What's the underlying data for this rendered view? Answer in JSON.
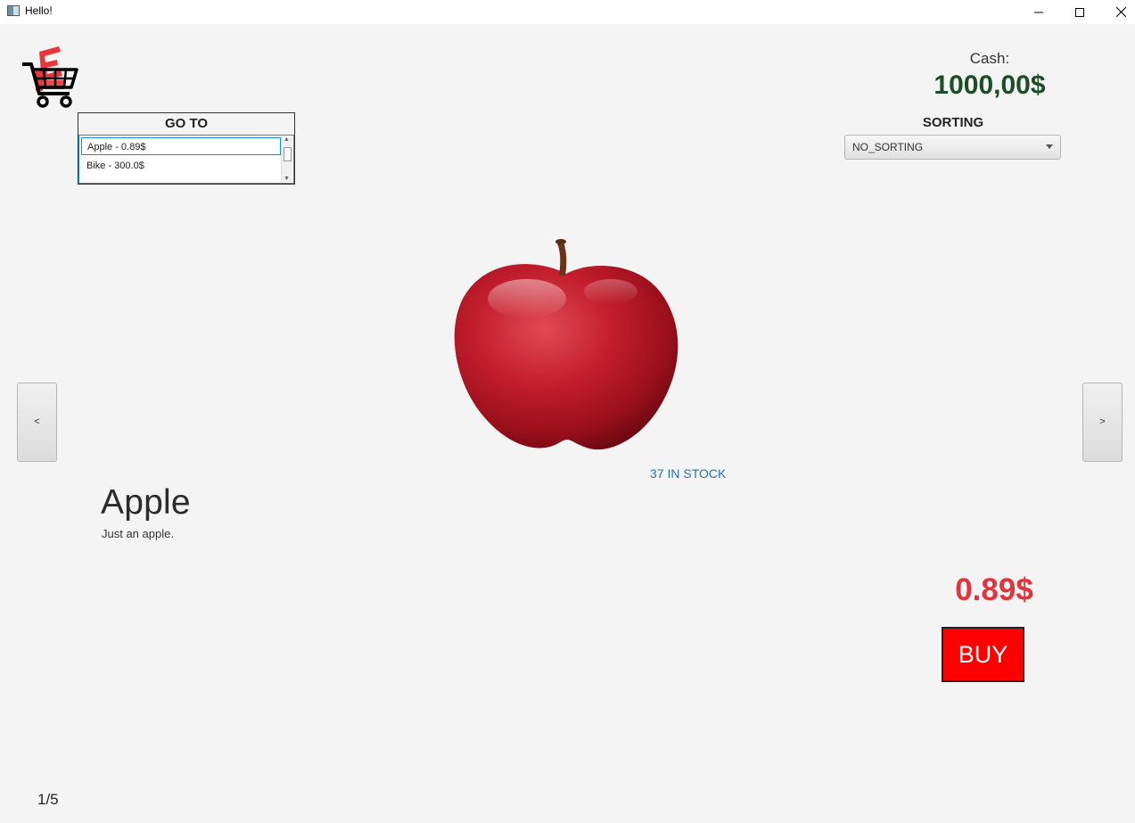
{
  "window": {
    "title": "Hello!",
    "minimize_icon": "minimize-icon",
    "maximize_icon": "maximize-icon",
    "close_icon": "close-icon"
  },
  "goto": {
    "header": "GO TO",
    "items": [
      "Apple - 0.89$",
      "Bike - 300.0$"
    ],
    "selected_index": 0
  },
  "cash": {
    "label": "Cash:",
    "value": "1000,00$"
  },
  "sorting": {
    "label": "SORTING",
    "selected": "NO_SORTING"
  },
  "navigation": {
    "prev_label": "<",
    "next_label": ">"
  },
  "product": {
    "stock": "37 IN STOCK",
    "name": "Apple",
    "description": "Just an apple.",
    "price": "0.89$",
    "buy_label": "BUY"
  },
  "page_indicator": "1/5",
  "colors": {
    "background": "#f4f4f4",
    "cash_green": "#1b4d26",
    "price_red": "#e3343b",
    "buy_red": "#ff0000",
    "stock_blue": "#2a6fbd",
    "list_focus_blue": "#1f8bd1"
  }
}
